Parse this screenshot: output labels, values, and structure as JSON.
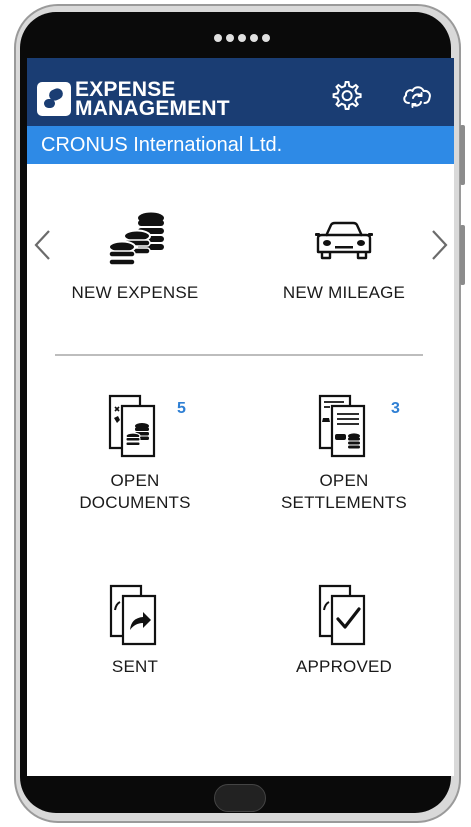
{
  "app": {
    "logo_line1": "EXPENSE",
    "logo_line2": "MANAGEMENT",
    "company": "CRONUS International Ltd.",
    "header_icons": [
      "gear-icon",
      "cloud-sync-icon"
    ]
  },
  "colors": {
    "header": "#1a3d73",
    "company_bar": "#2e8ae6",
    "badge": "#2e7fd4"
  },
  "tiles": {
    "new_expense": {
      "label": "NEW EXPENSE",
      "icon": "coins-icon"
    },
    "new_mileage": {
      "label": "NEW MILEAGE",
      "icon": "car-icon"
    },
    "open_documents": {
      "line1": "OPEN",
      "line2": "DOCUMENTS",
      "badge": "5",
      "icon": "documents-icon"
    },
    "open_settlements": {
      "line1": "OPEN",
      "line2": "SETTLEMENTS",
      "badge": "3",
      "icon": "settlements-icon"
    },
    "sent": {
      "label": "SENT",
      "icon": "sent-icon"
    },
    "approved": {
      "label": "APPROVED",
      "icon": "approved-icon"
    }
  }
}
